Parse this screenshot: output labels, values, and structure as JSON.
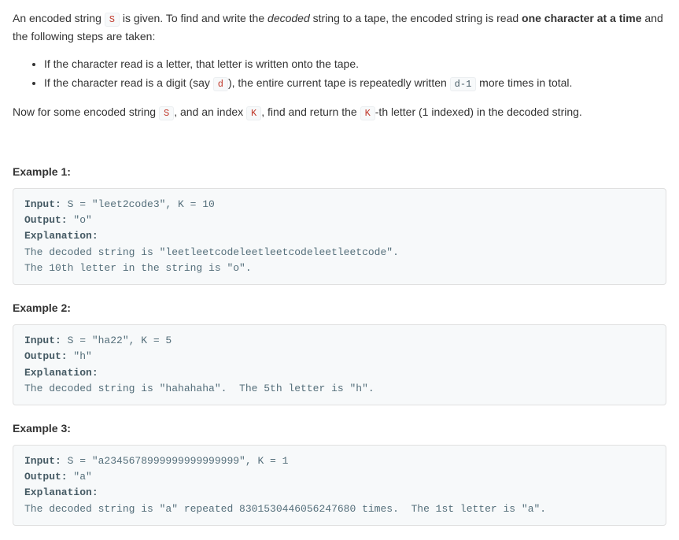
{
  "intro": {
    "p1_a": "An encoded string ",
    "p1_code": "S",
    "p1_b": " is given.  To find and write the ",
    "p1_em": "decoded",
    "p1_c": " string to a tape, the encoded string is read ",
    "p1_strong": "one character at a time",
    "p1_d": " and the following steps are taken:",
    "b1": "If the character read is a letter, that letter is written onto the tape.",
    "b2_a": "If the character read is a digit (say ",
    "b2_code1": "d",
    "b2_b": "), the entire current tape is repeatedly written ",
    "b2_code2": "d-1",
    "b2_c": " more times in total.",
    "p2_a": "Now for some encoded string ",
    "p2_code1": "S",
    "p2_b": ", and an index ",
    "p2_code2": "K",
    "p2_c": ", find and return the ",
    "p2_code3": "K",
    "p2_d": "-th letter (1 indexed) in the decoded string."
  },
  "examples": [
    {
      "heading": "Example 1:",
      "input_label": "Input:",
      "input_text": " S = \"leet2code3\", K = 10",
      "output_label": "Output:",
      "output_text": " \"o\"",
      "expl_label": "Explanation:",
      "expl_text": "\nThe decoded string is \"leetleetcodeleetleetcodeleetleetcode\".\nThe 10th letter in the string is \"o\"."
    },
    {
      "heading": "Example 2:",
      "input_label": "Input:",
      "input_text": " S = \"ha22\", K = 5",
      "output_label": "Output:",
      "output_text": " \"h\"",
      "expl_label": "Explanation:",
      "expl_text": "\nThe decoded string is \"hahahaha\".  The 5th letter is \"h\"."
    },
    {
      "heading": "Example 3:",
      "input_label": "Input:",
      "input_text": " S = \"a2345678999999999999999\", K = 1",
      "output_label": "Output:",
      "output_text": " \"a\"",
      "expl_label": "Explanation:",
      "expl_text": "\nThe decoded string is \"a\" repeated 8301530446056247680 times.  The 1st letter is \"a\"."
    }
  ]
}
